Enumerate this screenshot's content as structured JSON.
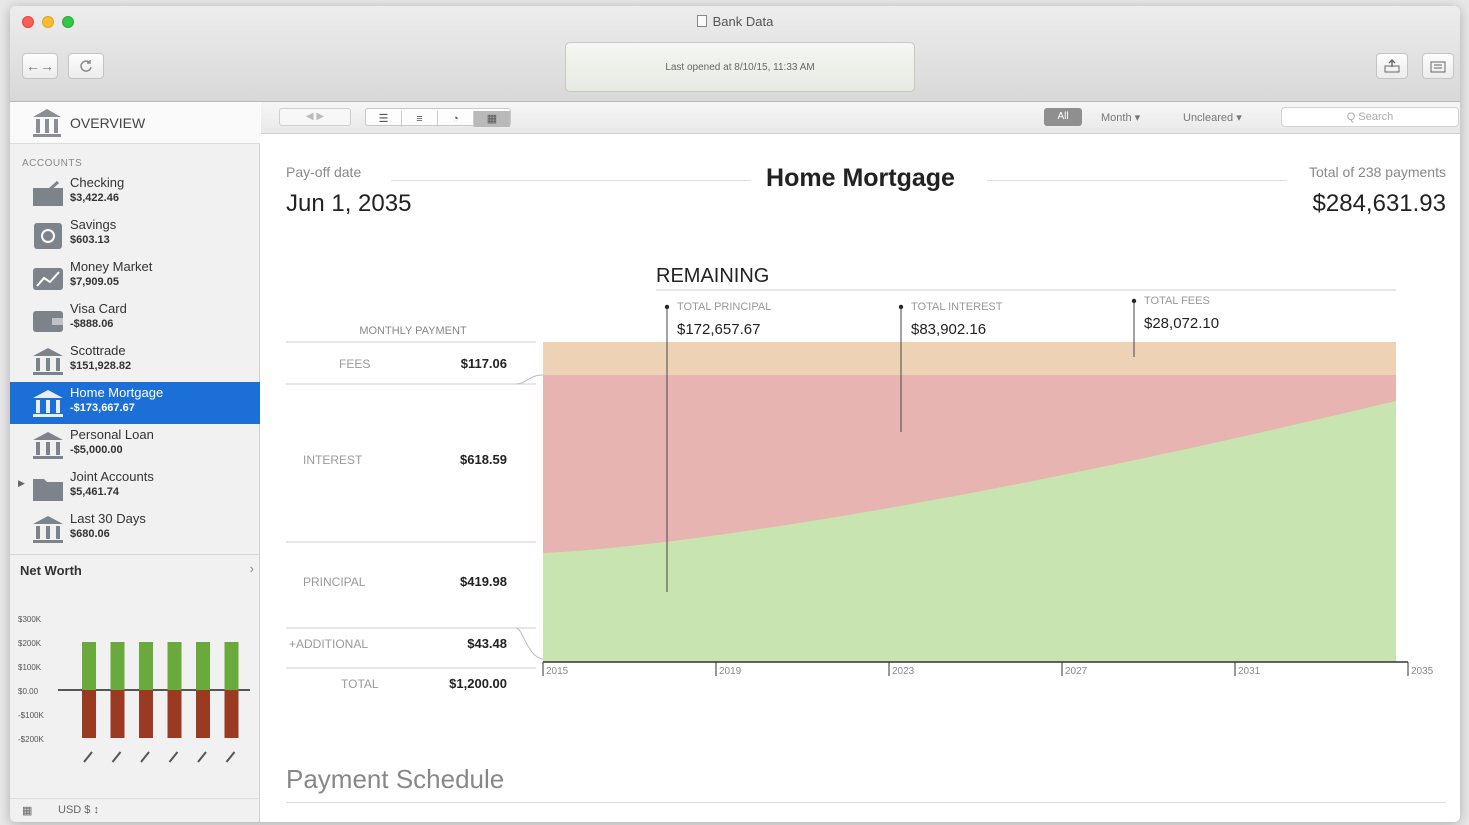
{
  "window": {
    "title": "Bank Data",
    "status": "Last opened at 8/10/15, 11:33 AM"
  },
  "toolbar": {
    "nav_label": "←→",
    "refresh_icon": "refresh-icon",
    "right_icons": [
      "export-icon",
      "import-icon"
    ]
  },
  "sidebar": {
    "overview_label": "OVERVIEW",
    "accounts_header": "ACCOUNTS",
    "accounts": [
      {
        "name": "Checking",
        "balance": "$3,422.46",
        "icon": "checkbook-icon"
      },
      {
        "name": "Savings",
        "balance": "$603.13",
        "icon": "safe-icon"
      },
      {
        "name": "Money Market",
        "balance": "$7,909.05",
        "icon": "money-market-icon"
      },
      {
        "name": "Visa Card",
        "balance": "-$888.06",
        "icon": "wallet-icon"
      },
      {
        "name": "Scottrade",
        "balance": "$151,928.82",
        "icon": "bank-icon"
      },
      {
        "name": "Home Mortgage",
        "balance": "-$173,667.67",
        "icon": "bank-icon"
      },
      {
        "name": "Personal Loan",
        "balance": "-$5,000.00",
        "icon": "bank-icon"
      },
      {
        "name": "Joint Accounts",
        "balance": "$5,461.74",
        "icon": "folder-icon"
      },
      {
        "name": "Last 30 Days",
        "balance": "$680.06",
        "icon": "bank-icon"
      }
    ],
    "selected_index": 5,
    "net_worth_label": "Net Worth",
    "net_worth_axis": [
      "$300K",
      "$200K",
      "$100K",
      "$0.00",
      "-$100K",
      "-$200K"
    ],
    "footer_currency": "USD $ ↕"
  },
  "subbar": {
    "view_buttons": [
      "list-view-icon",
      "detail-view-icon",
      "chart-view-icon",
      "schedule-view-icon"
    ],
    "all_label": "All",
    "month_dropdown": "Month ▾",
    "status_dropdown": "Uncleared ▾",
    "search_placeholder": "Q Search"
  },
  "main": {
    "payoff_label": "Pay-off date",
    "payoff_value": "Jun 1, 2035",
    "title": "Home Mortgage",
    "total_label": "Total of 238 payments",
    "total_value": "$284,631.93",
    "schedule_title": "Payment Schedule"
  },
  "chart_data": {
    "type": "area",
    "title": "REMAINING",
    "stack_order": [
      "Principal",
      "Interest",
      "Fees"
    ],
    "colors": {
      "principal": "#c8e4b0",
      "interest": "#e8b4b2",
      "fees": "#eed2b6"
    },
    "x_ticks": [
      "2015",
      "2019",
      "2023",
      "2027",
      "2031",
      "2035"
    ],
    "annotations": [
      {
        "label": "TOTAL PRINCIPAL",
        "value": "$172,657.67"
      },
      {
        "label": "TOTAL INTEREST",
        "value": "$83,902.16"
      },
      {
        "label": "TOTAL FEES",
        "value": "$28,072.10"
      }
    ],
    "monthly_payment": {
      "header": "MONTHLY PAYMENT",
      "rows": [
        {
          "label": "FEES",
          "value": "$117.06"
        },
        {
          "label": "INTEREST",
          "value": "$618.59"
        },
        {
          "label": "PRINCIPAL",
          "value": "$419.98"
        },
        {
          "label": "+ADDITIONAL",
          "value": "$43.48"
        },
        {
          "label": "TOTAL",
          "value": "$1,200.00"
        }
      ]
    },
    "principal_share": {
      "x": [
        2015,
        2035
      ],
      "fraction_at_start": 0.38,
      "fraction_at_end": 0.91
    }
  }
}
